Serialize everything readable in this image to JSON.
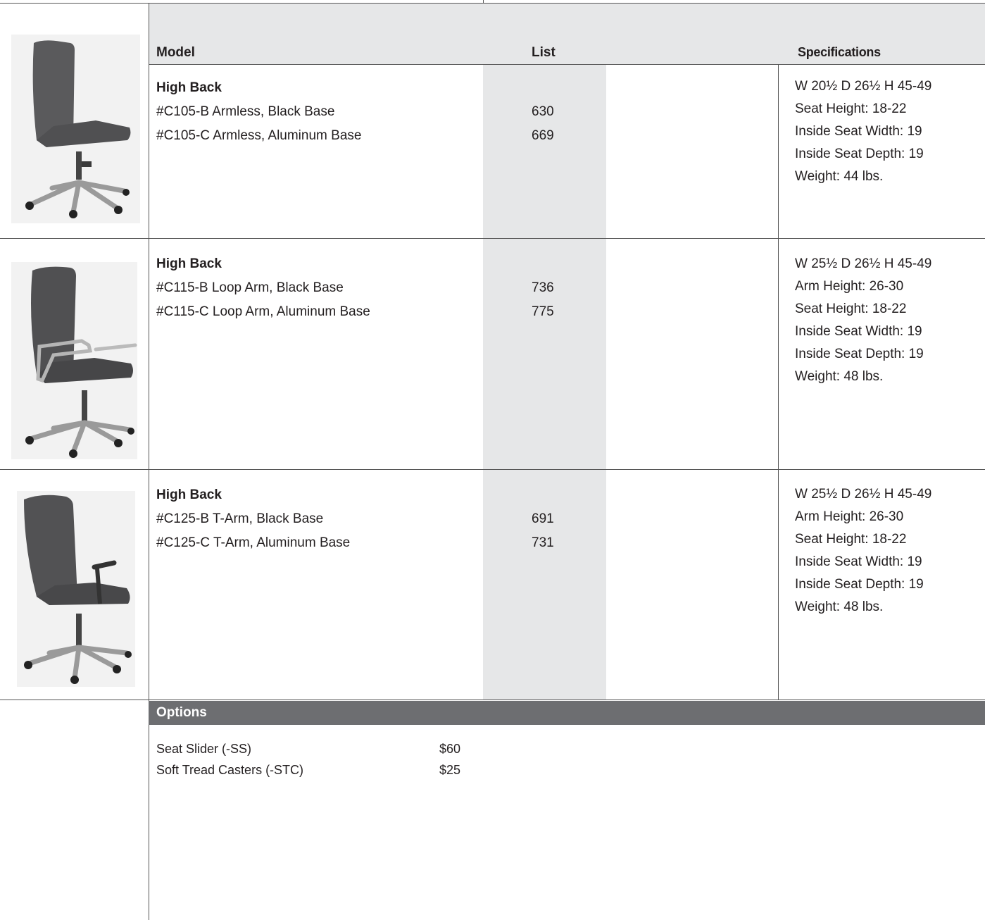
{
  "columns": {
    "model": "Model",
    "list": "List",
    "specifications": "Specifications"
  },
  "rows": [
    {
      "group": "High Back",
      "items": [
        {
          "model": "#C105-B Armless, Black Base",
          "price": "630"
        },
        {
          "model": "#C105-C Armless, Aluminum Base",
          "price": "669"
        }
      ],
      "specs": [
        "W 20½ D 26½ H 45-49",
        "Seat Height: 18-22",
        "Inside Seat Width: 19",
        "Inside Seat Depth: 19",
        "Weight: 44 lbs."
      ],
      "photo": "armless-chair-photo"
    },
    {
      "group": "High Back",
      "items": [
        {
          "model": "#C115-B Loop Arm, Black Base",
          "price": "736"
        },
        {
          "model": "#C115-C Loop Arm, Aluminum Base",
          "price": "775"
        }
      ],
      "specs": [
        "W 25½ D 26½ H 45-49",
        "Arm Height: 26-30",
        "Seat Height: 18-22",
        "Inside Seat Width: 19",
        "Inside Seat Depth: 19",
        "Weight: 48 lbs."
      ],
      "photo": "loop-arm-chair-photo"
    },
    {
      "group": "High Back",
      "items": [
        {
          "model": "#C125-B T-Arm, Black Base",
          "price": "691"
        },
        {
          "model": "#C125-C T-Arm, Aluminum Base",
          "price": "731"
        }
      ],
      "specs": [
        "W 25½ D 26½ H 45-49",
        "Arm Height: 26-30",
        "Seat Height: 18-22",
        "Inside Seat Width: 19",
        "Inside Seat Depth: 19",
        "Weight: 48 lbs."
      ],
      "photo": "t-arm-chair-photo"
    }
  ],
  "options": {
    "title": "Options",
    "items": [
      {
        "name": "Seat Slider (-SS)",
        "price": "$60"
      },
      {
        "name": "Soft Tread Casters (-STC)",
        "price": "$25"
      }
    ]
  },
  "colors": {
    "band": "#e6e7e8",
    "options_bar": "#6d6e71",
    "rule": "#555555"
  }
}
